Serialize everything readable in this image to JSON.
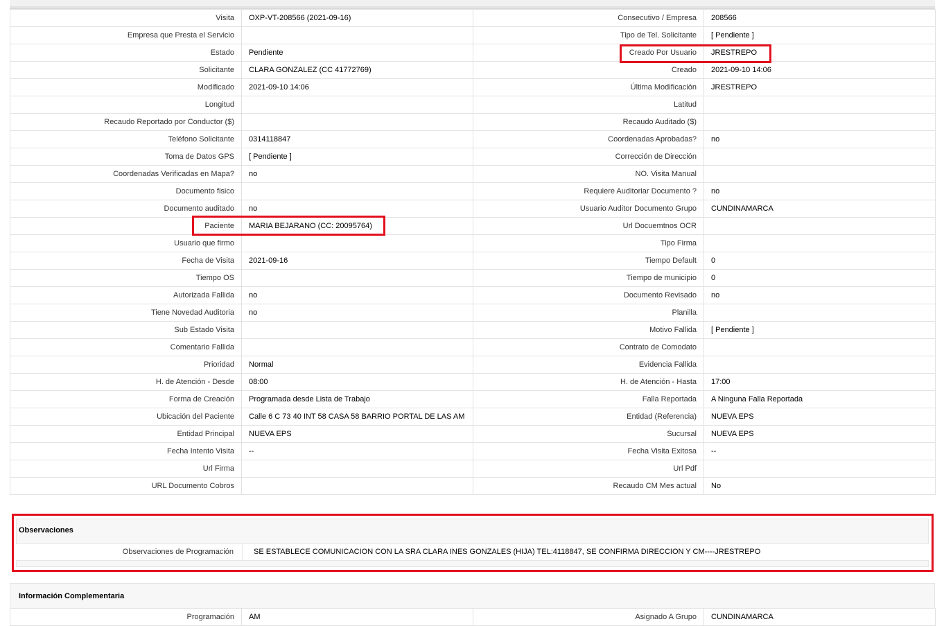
{
  "details": {
    "rows": [
      {
        "l1": "Visita",
        "v1": "OXP-VT-208566 (2021-09-16)",
        "l2": "Consecutivo / Empresa",
        "v2": "208566"
      },
      {
        "l1": "Empresa que Presta el Servicio",
        "v1": "",
        "l2": "Tipo de Tel. Solicitante",
        "v2": "[ Pendiente ]"
      },
      {
        "l1": "Estado",
        "v1": "Pendiente",
        "l2": "Creado Por Usuario",
        "v2": "JRESTREPO"
      },
      {
        "l1": "Solicitante",
        "v1": "CLARA GONZALEZ (CC 41772769)",
        "l2": "Creado",
        "v2": "2021-09-10 14:06"
      },
      {
        "l1": "Modificado",
        "v1": "2021-09-10 14:06",
        "l2": "Última Modificación",
        "v2": " JRESTREPO"
      },
      {
        "l1": "Longitud",
        "v1": "",
        "l2": "Latitud",
        "v2": ""
      },
      {
        "l1": "Recaudo Reportado por Conductor ($)",
        "v1": "",
        "l2": "Recaudo Auditado ($)",
        "v2": ""
      },
      {
        "l1": "Teléfono Solicitante",
        "v1": "0314118847",
        "l2": "Coordenadas Aprobadas?",
        "v2": " no"
      },
      {
        "l1": "Toma de Datos GPS",
        "v1": "[ Pendiente ]",
        "l2": "Corrección de Dirección",
        "v2": ""
      },
      {
        "l1": "Coordenadas Verificadas en Mapa?",
        "v1": " no",
        "l2": "NO. Visita Manual",
        "v2": ""
      },
      {
        "l1": "Documento fisico",
        "v1": "",
        "l2": "Requiere Auditoriar Documento ?",
        "v2": " no"
      },
      {
        "l1": "Documento auditado",
        "v1": " no",
        "l2": "Usuario Auditor Documento Grupo",
        "v2": "CUNDINAMARCA"
      },
      {
        "l1": "Paciente",
        "v1": "MARIA BEJARANO (CC: 20095764)",
        "l2": "Url Docuemtnos OCR",
        "v2": ""
      },
      {
        "l1": "Usuario que firmo",
        "v1": "",
        "l2": "Tipo Firma",
        "v2": ""
      },
      {
        "l1": "Fecha de Visita",
        "v1": " 2021-09-16",
        "l2": "Tiempo Default",
        "v2": "0"
      },
      {
        "l1": "Tiempo OS",
        "v1": "",
        "l2": "Tiempo de municipio",
        "v2": "0"
      },
      {
        "l1": "Autorizada Fallida",
        "v1": " no",
        "l2": "Documento Revisado",
        "v2": " no"
      },
      {
        "l1": "Tiene Novedad Auditoria",
        "v1": " no",
        "l2": "Planilla",
        "v2": ""
      },
      {
        "l1": "Sub Estado Visita",
        "v1": "",
        "l2": "Motivo Fallida",
        "v2": "[ Pendiente ]"
      },
      {
        "l1": "Comentario Fallida",
        "v1": "",
        "l2": "Contrato de Comodato",
        "v2": ""
      },
      {
        "l1": "Prioridad",
        "v1": "Normal",
        "l2": "Evidencia Fallida",
        "v2": ""
      },
      {
        "l1": "H. de Atención - Desde",
        "v1": "08:00",
        "l2": "H. de Atención - Hasta",
        "v2": "17:00"
      },
      {
        "l1": "Forma de Creación",
        "v1": "Programada desde Lista de Trabajo",
        "l2": "Falla Reportada",
        "v2": "A Ninguna Falla Reportada"
      },
      {
        "l1": "Ubicación del Paciente",
        "v1": "Calle 6 C 73 40 INT 58 CASA 58 BARRIO PORTAL DE LAS AM",
        "l2": "Entidad (Referencia)",
        "v2": "NUEVA EPS"
      },
      {
        "l1": "Entidad Principal",
        "v1": "NUEVA EPS",
        "l2": "Sucursal",
        "v2": "NUEVA EPS"
      },
      {
        "l1": "Fecha Intento Visita",
        "v1": " --",
        "l2": "Fecha Visita Exitosa",
        "v2": " --"
      },
      {
        "l1": "Url Firma",
        "v1": "",
        "l2": "Url Pdf",
        "v2": ""
      },
      {
        "l1": "URL Documento Cobros",
        "v1": "",
        "l2": "Recaudo CM Mes actual",
        "v2": "No"
      }
    ]
  },
  "observaciones": {
    "title": "Observaciones",
    "label": "Observaciones de Programación",
    "value": "SE ESTABLECE COMUNICACION CON LA SRA CLARA INES GONZALES (HIJA) TEL:4118847, SE CONFIRMA DIRECCION Y CM----JRESTREPO"
  },
  "complementaria": {
    "title": "Información Complementaria",
    "l1": "Programación",
    "v1": "AM",
    "l2": "Asignado A Grupo",
    "v2": "CUNDINAMARCA"
  },
  "colors": {
    "highlight": "#e3101e",
    "border": "#e2e2e2",
    "panel": "#f7f7f7"
  }
}
